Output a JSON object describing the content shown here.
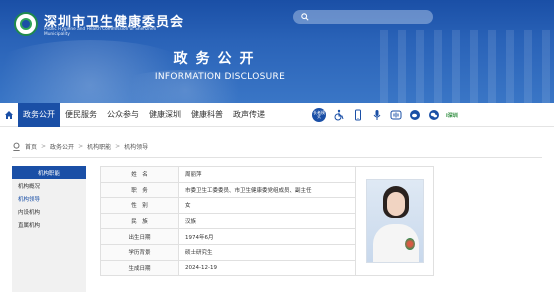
{
  "header": {
    "site_name": "深圳市卫生健康委员会",
    "site_subtitle": "Public Hygiene and Health Commission of Shenzhen Municipality",
    "section_title_cn": "政务公开",
    "section_title_en": "INFORMATION DISCLOSURE",
    "search_placeholder": ""
  },
  "nav": {
    "items": [
      {
        "label": "政务公开",
        "active": true
      },
      {
        "label": "便民服务",
        "active": false
      },
      {
        "label": "公众参与",
        "active": false
      },
      {
        "label": "健康深圳",
        "active": false
      },
      {
        "label": "健康科普",
        "active": false
      },
      {
        "label": "政声传递",
        "active": false
      }
    ],
    "tools": [
      "accessibility-care-icon",
      "wheelchair-icon",
      "mobile-icon",
      "microphone-icon",
      "audio-wave-icon",
      "weibo-icon",
      "wechat-icon",
      "i-shenzhen-logo"
    ],
    "care_label": "长者模式",
    "brand_label": "i深圳"
  },
  "breadcrumb": {
    "items": [
      "首页",
      "政务公开",
      "机构职能",
      "机构领导"
    ]
  },
  "sidebar": {
    "heading": "机构职能",
    "items": [
      {
        "label": "机构概况",
        "active": false
      },
      {
        "label": "机构领导",
        "active": true
      },
      {
        "label": "内设机构",
        "active": false
      },
      {
        "label": "直属机构",
        "active": false
      }
    ]
  },
  "profile": {
    "rows": [
      {
        "key": "姓　名",
        "value": "周丽萍"
      },
      {
        "key": "职　务",
        "value": "市委卫生工委委员、市卫生健康委党组成员、副主任"
      },
      {
        "key": "性　别",
        "value": "女"
      },
      {
        "key": "民　族",
        "value": "汉族"
      },
      {
        "key": "出生日期",
        "value": "1974年6月"
      },
      {
        "key": "学历背景",
        "value": "硕士研究生"
      },
      {
        "key": "生成日期",
        "value": "2024-12-19"
      }
    ]
  },
  "colors": {
    "primary": "#1a4fa6",
    "banner": "#2a63b8"
  }
}
